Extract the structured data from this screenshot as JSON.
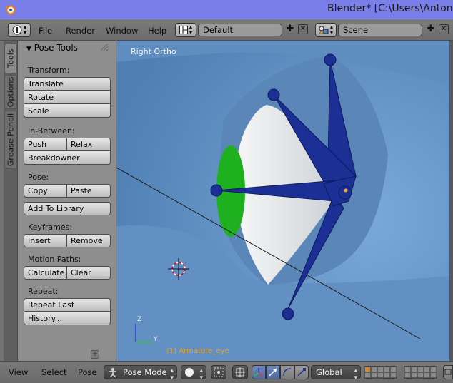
{
  "window": {
    "title": "Blender* [C:\\Users\\Antonio"
  },
  "info_header": {
    "menus": [
      "File",
      "Render",
      "Window",
      "Help"
    ],
    "screen_layout": "Default",
    "scene": "Scene"
  },
  "tabs": [
    "Tools",
    "Options",
    "Grease Pencil"
  ],
  "tool_shelf": {
    "panel_title": "Pose Tools",
    "transform": {
      "label": "Transform:",
      "buttons": [
        "Translate",
        "Rotate",
        "Scale"
      ]
    },
    "in_between": {
      "label": "In-Between:",
      "push": "Push",
      "relax": "Relax",
      "breakdowner": "Breakdowner"
    },
    "pose": {
      "label": "Pose:",
      "copy": "Copy",
      "paste": "Paste",
      "add_to_library": "Add To Library"
    },
    "keyframes": {
      "label": "Keyframes:",
      "insert": "Insert",
      "remove": "Remove"
    },
    "motion_paths": {
      "label": "Motion Paths:",
      "calculate": "Calculate",
      "clear": "Clear"
    },
    "repeat": {
      "label": "Repeat:",
      "repeat_last": "Repeat Last",
      "history": "History..."
    }
  },
  "viewport": {
    "view_label": "Right Ortho",
    "object_label": "(1) Armature_eye",
    "axis_z": "Z",
    "axis_y": "Y"
  },
  "bottom_header": {
    "menus": [
      "View",
      "Select",
      "Pose"
    ],
    "mode": "Pose Mode",
    "orientation": "Global"
  },
  "colors": {
    "titlebar": "#7a7ee8",
    "viewport_bg": "#6c9bcd",
    "bone": "#1b2f94",
    "iris": "#1fb01f",
    "object_label": "#e8a022"
  }
}
